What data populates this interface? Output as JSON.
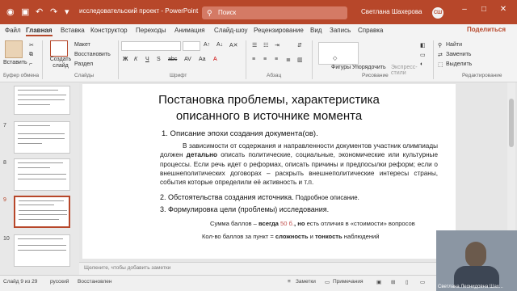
{
  "titlebar": {
    "app_title": "исследовательский проект - PowerPoint",
    "search_placeholder": "Поиск",
    "user_name": "Светлана Шахерова",
    "user_initials": "СШ"
  },
  "tabs": [
    "Файл",
    "Главная",
    "Вставка",
    "Конструктор",
    "Переходы",
    "Анимация",
    "Слайд-шоу",
    "Рецензирование",
    "Вид",
    "Запись",
    "Справка"
  ],
  "share_label": "Поделиться",
  "ribbon": {
    "paste": "Вставить",
    "new_slide": "Создать слайд",
    "layout": "Макет",
    "reset": "Восстановить",
    "section": "Раздел",
    "shapes": "Фигуры",
    "arrange": "Упорядочить",
    "styles": "Экспресс-стили",
    "find": "Найти",
    "replace": "Заменить",
    "select": "Выделить",
    "groups": {
      "clipboard": "Буфер обмена",
      "slides": "Слайды",
      "font": "Шрифт",
      "paragraph": "Абзац",
      "drawing": "Рисование",
      "editing": "Редактирование"
    }
  },
  "thumbs": [
    {
      "num": "",
      "selected": false
    },
    {
      "num": "7",
      "selected": false
    },
    {
      "num": "8",
      "selected": false
    },
    {
      "num": "9",
      "selected": true
    },
    {
      "num": "10",
      "selected": false
    }
  ],
  "slide": {
    "title_line1": "Постановка проблемы, характеристика",
    "title_line2": "описанного в источнике момента",
    "item1": "1.    Описание эпохи создания документа(ов).",
    "para_part1": "В зависимости от содержания и направленности документов участник олимпиады должен ",
    "para_bold": "детально",
    "para_part2": " описать политические, социальные, экономические или культурные процессы. Если речь идет о реформах, описать причины и предпосылки реформ; если о внешнеполитических договорах – раскрыть внешнеполитические интересы страны, события которые определили её активность и т.п.",
    "item2_bold": "2. Обстоятельства создания источника.",
    "item2_rest": " Подробное описание.",
    "item3": "3. Формулировка цели (проблемы) исследования.",
    "sum1_a": "Сумма баллов – ",
    "sum1_b": "всегда",
    "sum1_c": "50 б.",
    "sum1_d": ", но",
    "sum1_e": " есть отличия в «стоимости» вопросов",
    "sum2_a": "Кол-во баллов за пункт = ",
    "sum2_b": "сложность",
    "sum2_c": " и ",
    "sum2_d": "тонкость",
    "sum2_e": " наблюдений",
    "accent": "#c0504d"
  },
  "notes_placeholder": "Щелкните, чтобы добавить заметки",
  "status": {
    "slide_count": "Слайд 9 из 29",
    "language": "русский",
    "recovered": "Восстановлен",
    "notes": "Заметки",
    "comments": "Примечания"
  },
  "webcam": {
    "name": "Светлана Леонидовна Шах..."
  }
}
